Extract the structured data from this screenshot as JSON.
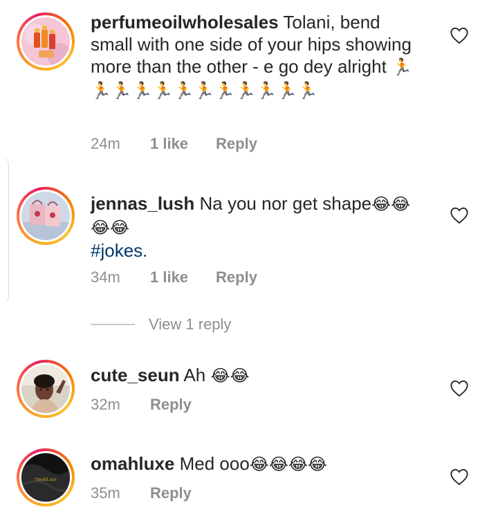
{
  "comments": [
    {
      "username": "perfumeoilwholesales",
      "text": "Tolani, bend small with one side of your hips showing more than the other - e go dey alright",
      "emojis": "🏃🏃🏃🏃🏃🏃🏃🏃🏃🏃🏃🏃",
      "time": "24m",
      "likes": "1 like",
      "reply": "Reply"
    },
    {
      "username": "jennas_lush",
      "text": "Na you nor get shape",
      "emojis": "😂😂😂😂",
      "hashtag": "#jokes.",
      "time": "34m",
      "likes": "1 like",
      "reply": "Reply",
      "view_replies": "View 1 reply"
    },
    {
      "username": "cute_seun",
      "text": "Ah",
      "emojis": "😂😂",
      "time": "32m",
      "reply": "Reply"
    },
    {
      "username": "omahluxe",
      "text": "Med ooo",
      "emojis": "😂😂😂😂",
      "time": "35m",
      "reply": "Reply"
    }
  ],
  "avatar_logos": {
    "omahluxe": "OmahLuxe"
  },
  "colors": {
    "text": "#262626",
    "meta": "#8e8e8e",
    "hashtag": "#00376b",
    "ring": "#f57c00"
  },
  "icons": [
    "heart-icon"
  ]
}
